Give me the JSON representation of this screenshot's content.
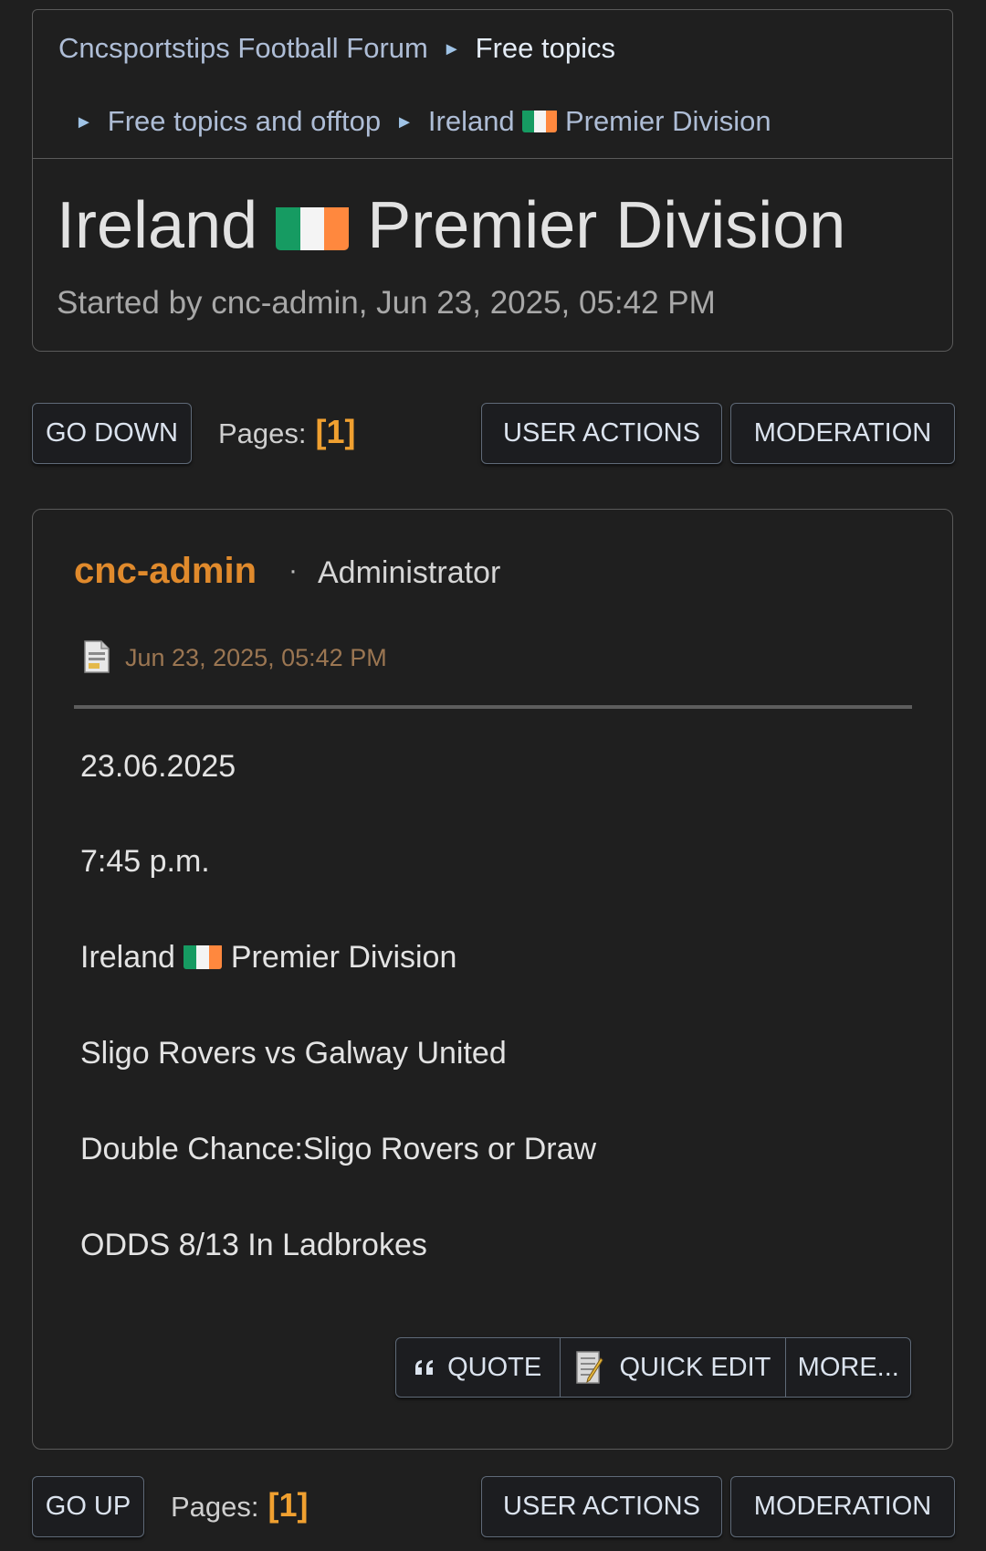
{
  "breadcrumb": {
    "forum": "Cncsportstips Football Forum",
    "board": "Free topics",
    "subboard": "Free topics and offtop",
    "topic_pre": "Ireland",
    "topic_post": "Premier Division",
    "separator": "►"
  },
  "topic": {
    "title_pre": "Ireland",
    "title_post": "Premier Division",
    "started": "Started by cnc-admin, Jun 23, 2025, 05:42 PM"
  },
  "nav_top": {
    "go_down": "GO DOWN",
    "pages_label": "Pages:",
    "pages_value": "[1]",
    "user_actions": "USER ACTIONS",
    "moderation": "MODERATION"
  },
  "post": {
    "author": "cnc-admin",
    "dot": "·",
    "role": "Administrator",
    "date": "Jun 23, 2025, 05:42 PM",
    "lines": {
      "date": "23.06.2025",
      "time": "7:45 p.m.",
      "league_pre": "Ireland",
      "league_post": "Premier Division",
      "match": "Sligo Rovers vs Galway United",
      "tip": "Double Chance:Sligo Rovers or Draw",
      "odds": "ODDS 8/13 In Ladbrokes"
    },
    "actions": {
      "quote": "QUOTE",
      "quick_edit": "QUICK EDIT",
      "more": "MORE..."
    }
  },
  "nav_bottom": {
    "go_up": "GO UP",
    "pages_label": "Pages:",
    "pages_value": "[1]",
    "user_actions": "USER ACTIONS",
    "moderation": "MODERATION"
  },
  "colors": {
    "background": "#1f1f1f",
    "author": "#e08a2c",
    "page_number": "#f0a030",
    "link": "#aebdd6"
  },
  "icons": [
    "ireland-flag-icon",
    "post-document-icon",
    "quote-icon",
    "quick-edit-icon"
  ]
}
